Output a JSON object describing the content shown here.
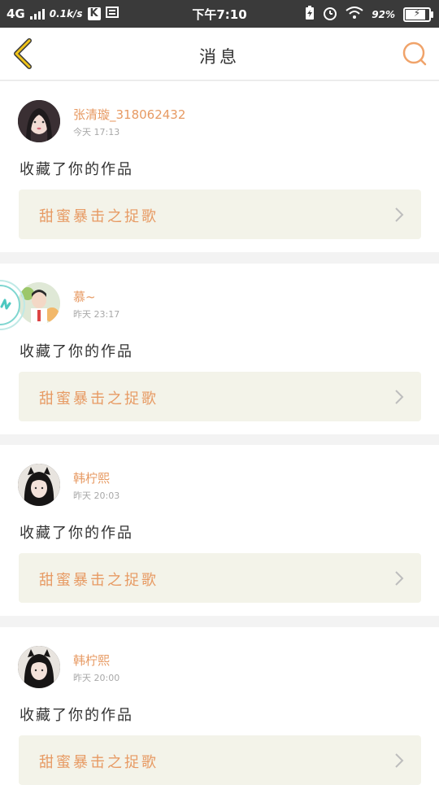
{
  "status_bar": {
    "network": "4G",
    "speed": "0.1k/s",
    "app_k_icon": "K",
    "time": "下午7:10",
    "battery_percent": "92%",
    "battery_level": 0.92
  },
  "header": {
    "title": "消息",
    "back_icon": "chevron-left-icon",
    "search_icon": "search-icon"
  },
  "colors": {
    "accent": "#e79a63",
    "back_chevron": "#f0c419",
    "card_link_bg": "#f3f3e9",
    "status_bar_bg": "#3a3a3a"
  },
  "messages": [
    {
      "username": "张清璇_318062432",
      "time": "今天  17:13",
      "action": "收藏了你的作品",
      "work_title": "甜蜜暴击之捉歌"
    },
    {
      "username": "慕~",
      "time": "昨天  23:17",
      "action": "收藏了你的作品",
      "work_title": "甜蜜暴击之捉歌"
    },
    {
      "username": "韩柠熙",
      "time": "昨天  20:03",
      "action": "收藏了你的作品",
      "work_title": "甜蜜暴击之捉歌"
    },
    {
      "username": "韩柠熙",
      "time": "昨天  20:00",
      "action": "收藏了你的作品",
      "work_title": "甜蜜暴击之捉歌"
    }
  ]
}
